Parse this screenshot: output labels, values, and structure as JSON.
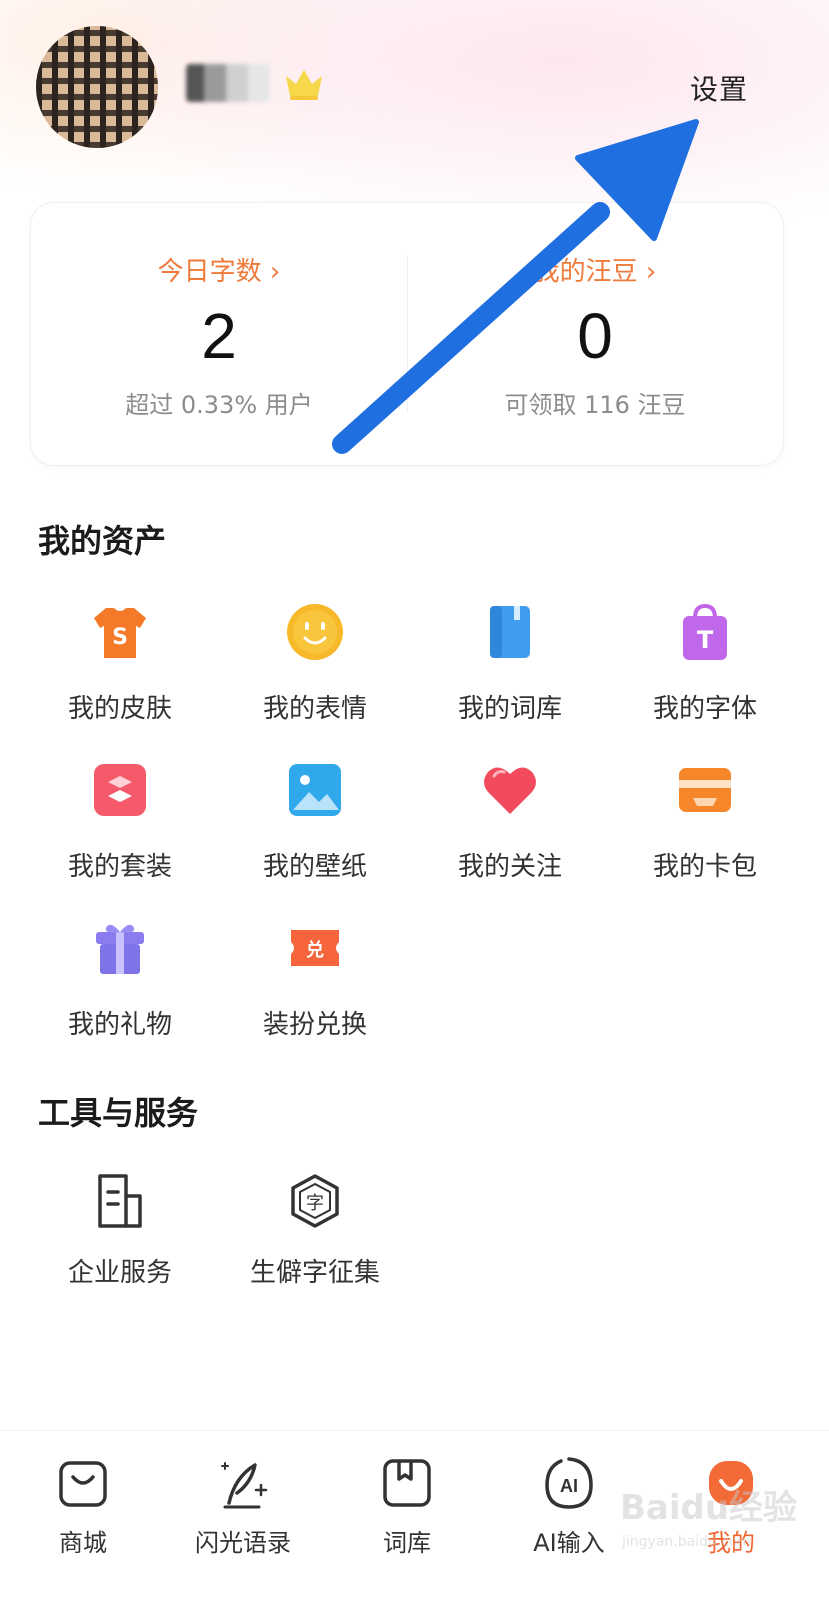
{
  "header": {
    "settings_label": "设置"
  },
  "stats": {
    "left": {
      "link": "今日字数 ›",
      "value": "2",
      "sub": "超过 0.33% 用户"
    },
    "right": {
      "link": "我的汪豆 ›",
      "value": "0",
      "sub": "可领取 116 汪豆"
    }
  },
  "assets": {
    "title": "我的资产",
    "items": [
      {
        "label": "我的皮肤",
        "icon": "shirt-icon"
      },
      {
        "label": "我的表情",
        "icon": "smiley-icon"
      },
      {
        "label": "我的词库",
        "icon": "book-icon"
      },
      {
        "label": "我的字体",
        "icon": "font-bag-icon"
      },
      {
        "label": "我的套装",
        "icon": "suit-icon"
      },
      {
        "label": "我的壁纸",
        "icon": "wallpaper-icon"
      },
      {
        "label": "我的关注",
        "icon": "heart-icon"
      },
      {
        "label": "我的卡包",
        "icon": "wallet-icon"
      },
      {
        "label": "我的礼物",
        "icon": "gift-icon"
      },
      {
        "label": "装扮兑换",
        "icon": "ticket-icon"
      }
    ]
  },
  "tools": {
    "title": "工具与服务",
    "items": [
      {
        "label": "企业服务",
        "icon": "enterprise-icon"
      },
      {
        "label": "生僻字征集",
        "icon": "rare-char-icon"
      }
    ]
  },
  "bottom_nav": {
    "items": [
      {
        "label": "商城",
        "icon": "shop-bag-icon"
      },
      {
        "label": "闪光语录",
        "icon": "quill-icon"
      },
      {
        "label": "词库",
        "icon": "bookmark-book-icon"
      },
      {
        "label": "AI输入",
        "icon": "ai-icon"
      },
      {
        "label": "我的",
        "icon": "profile-icon"
      }
    ]
  },
  "watermark": {
    "line1": "Baidu经验",
    "line2": "jingyan.baidu.com"
  },
  "colors": {
    "accent": "#ef7a3a",
    "active_tab": "#f0642d",
    "arrow": "#1f6fe0"
  }
}
